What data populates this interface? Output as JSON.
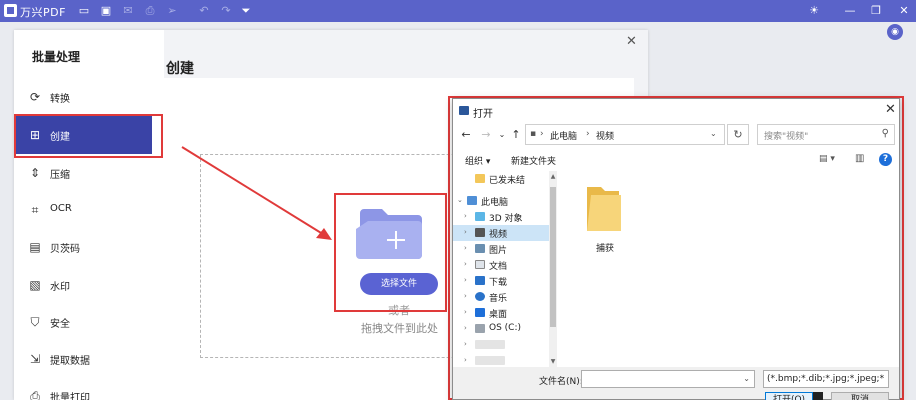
{
  "app": {
    "title": "万兴PDF",
    "colors": {
      "brand": "#5a63c9",
      "active_nav": "#3a43a6",
      "button": "#5a63d3",
      "annotation_red": "#e03a3a"
    }
  },
  "sidebar": {
    "title": "批量处理",
    "items": [
      {
        "label": "转换",
        "icon": "convert-icon"
      },
      {
        "label": "创建",
        "icon": "create-icon",
        "active": true
      },
      {
        "label": "压缩",
        "icon": "compress-icon"
      },
      {
        "label": "OCR",
        "icon": "ocr-icon"
      },
      {
        "label": "贝茨码",
        "icon": "bates-icon"
      },
      {
        "label": "水印",
        "icon": "watermark-icon"
      },
      {
        "label": "安全",
        "icon": "security-icon"
      },
      {
        "label": "提取数据",
        "icon": "extract-data-icon"
      },
      {
        "label": "批量打印",
        "icon": "print-icon"
      }
    ]
  },
  "content": {
    "title": "创建",
    "select_file_button": "选择文件",
    "or_text": "或者",
    "drag_text": "拖拽文件到此处"
  },
  "dialog": {
    "title": "打开",
    "breadcrumb": [
      "此电脑",
      "视频"
    ],
    "search_placeholder": "搜索\"视频\"",
    "organize_label": "组织 ▾",
    "new_folder_label": "新建文件夹",
    "tree": [
      {
        "label": "已发未结",
        "icon": "folder-icon"
      },
      {
        "label": "此电脑",
        "icon": "computer-icon"
      },
      {
        "label": "3D 对象",
        "icon": "3d-objects-icon"
      },
      {
        "label": "视频",
        "icon": "video-icon",
        "selected": true
      },
      {
        "label": "图片",
        "icon": "pictures-icon"
      },
      {
        "label": "文档",
        "icon": "documents-icon"
      },
      {
        "label": "下载",
        "icon": "download-icon"
      },
      {
        "label": "音乐",
        "icon": "music-icon"
      },
      {
        "label": "桌面",
        "icon": "desktop-icon"
      },
      {
        "label": "OS (C:)",
        "icon": "drive-icon"
      }
    ],
    "files": [
      {
        "name": "捕获",
        "icon": "folder-icon"
      }
    ],
    "filename_label": "文件名(N):",
    "filename_value": "",
    "filetype_value": "(*.bmp;*.dib;*.jpg;*.jpeg;*.jpe",
    "open_button": "打开(O)",
    "cancel_button": "取消"
  }
}
